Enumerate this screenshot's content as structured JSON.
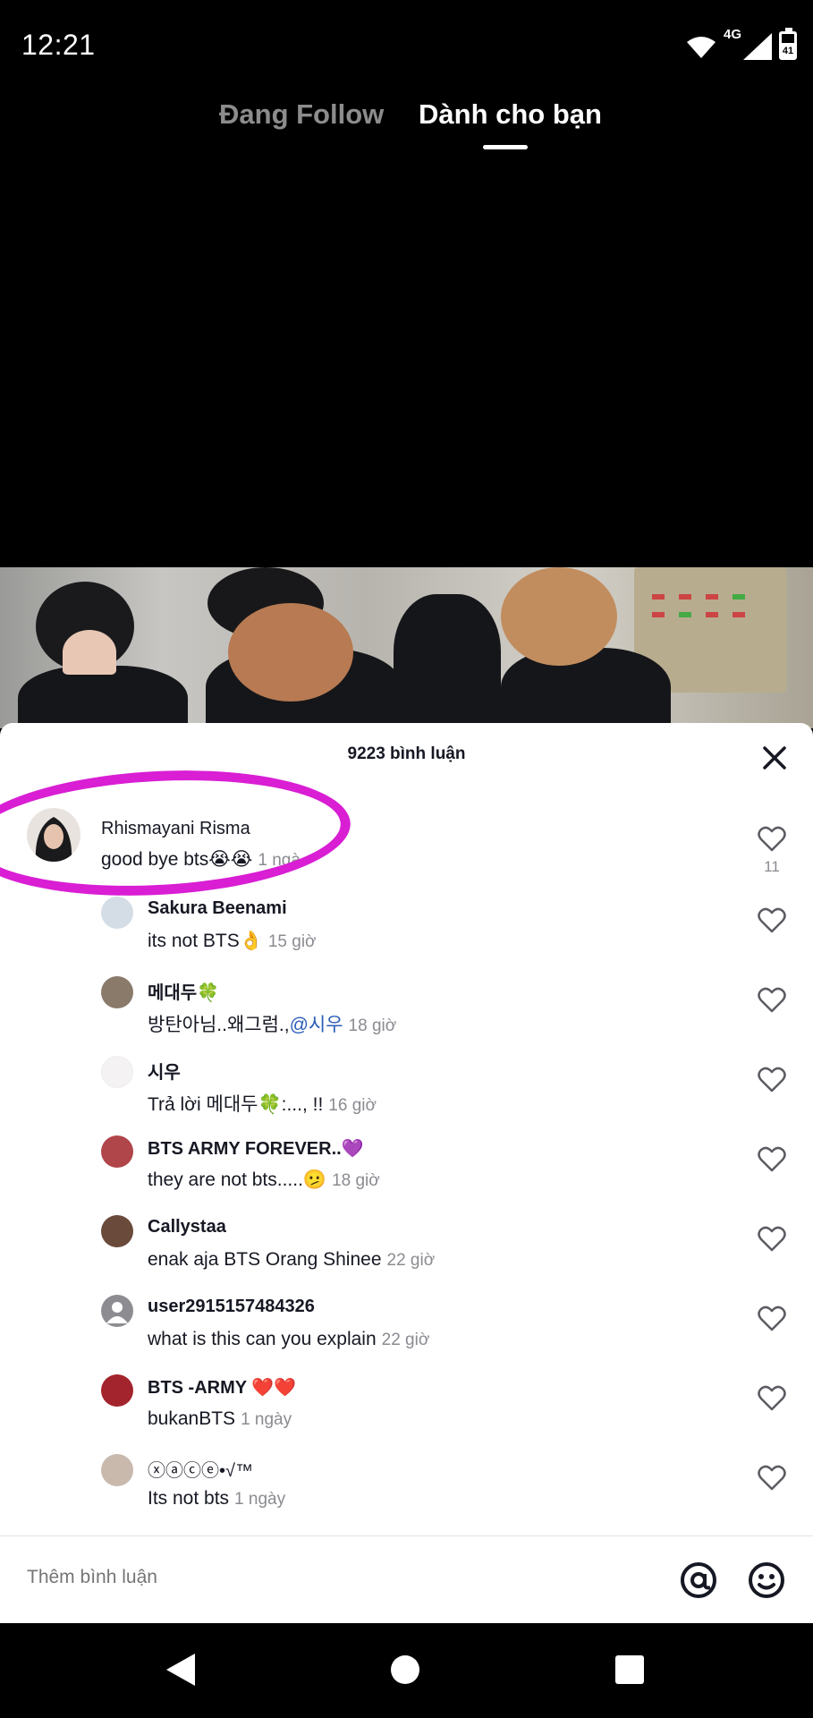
{
  "status_bar": {
    "time": "12:21",
    "network": "4G",
    "battery": "41"
  },
  "top_tabs": {
    "following": "Đang Follow",
    "for_you": "Dành cho bạn"
  },
  "comments_header": {
    "count_label": "9223 bình luận"
  },
  "comments": [
    {
      "user": "Rhismayani Risma",
      "text": "good bye bts😭😭",
      "time": "1 ngà",
      "likes": "11"
    },
    {
      "user": "Sakura Beenami",
      "text": "its not BTS👌",
      "time": "15 giờ"
    },
    {
      "user": "메대두🍀",
      "text": "방탄아님..왜그럼.,",
      "mention": "@시우",
      "time": "18 giờ"
    },
    {
      "user": "시우",
      "reply_prefix": "Trả lời ",
      "reply_to": "메대두🍀",
      "text": ":..., !!",
      "time": "16 giờ"
    },
    {
      "user": "BTS ARMY FOREVER..💜",
      "text": "they are not bts.....🫤",
      "time": "18 giờ"
    },
    {
      "user": "Callystaa",
      "text": "enak aja BTS Orang Shinee",
      "time": "22 giờ"
    },
    {
      "user": "user2915157484326",
      "text": "what is this can you explain",
      "time": "22 giờ"
    },
    {
      "user": "BTS -ARMY ❤️❤️",
      "text": "bukanBTS",
      "time": "1 ngày"
    },
    {
      "user": "ⓧⓐⓒⓔ•√™",
      "text": "Its not bts",
      "time": "1 ngày"
    }
  ],
  "input_bar": {
    "placeholder": "Thêm bình luận"
  },
  "colors": {
    "highlight": "#d91ed4",
    "mention": "#2b5db9",
    "muted": "#8a8b91"
  },
  "icons": [
    "close-icon",
    "heart-icon",
    "at-icon",
    "emoji-icon",
    "back-icon",
    "home-icon",
    "recents-icon",
    "wifi-icon",
    "signal-icon",
    "battery-icon"
  ]
}
